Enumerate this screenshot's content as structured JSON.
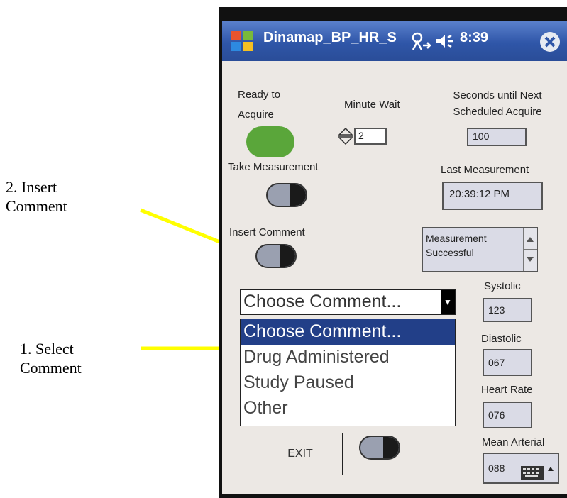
{
  "annotations": {
    "insert_line1": "2. Insert",
    "insert_line2": "Comment",
    "select_line1": "1. Select",
    "select_line2": "Comment"
  },
  "titlebar": {
    "title": "Dinamap_BP_HR_S",
    "time": "8:39"
  },
  "status": {
    "ready_line1": "Ready to",
    "ready_line2": "Acquire",
    "ready_color": "#5aa63a",
    "minute_wait_label": "Minute Wait",
    "minute_wait_value": "2",
    "seconds_line1": "Seconds until Next",
    "seconds_line2": "Scheduled Acquire",
    "seconds_value": "100"
  },
  "take_measurement_label": "Take Measurement",
  "last_measurement_label": "Last Measurement",
  "last_measurement_value": "20:39:12 PM",
  "insert_comment_label": "Insert Comment",
  "message_line1": "Measurement",
  "message_line2": "Successful",
  "comment": {
    "selected": "Choose Comment...",
    "options": [
      "Choose Comment...",
      "Drug Administered",
      "Study Paused",
      "Other"
    ]
  },
  "vitals": {
    "systolic_label": "Systolic",
    "systolic": "123",
    "diastolic_label": "Diastolic",
    "diastolic": "067",
    "heart_rate_label": "Heart Rate",
    "heart_rate": "076",
    "mean_arterial_label": "Mean Arterial",
    "mean_arterial": "088"
  },
  "exit_label": "EXIT",
  "accent": "#ffff00"
}
